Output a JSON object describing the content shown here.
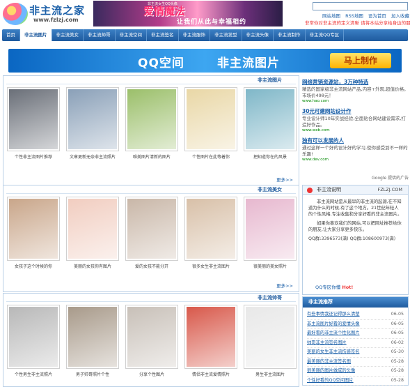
{
  "header": {
    "logo_text": "非主流之家",
    "logo_domain": "www.fzlzj.com",
    "banner_title": "爱情魔法",
    "banner_sub": "让我们从此与幸福相约",
    "banner_small": "非主流女生QQ头像",
    "top_links": [
      "网站地图",
      "RSS地图",
      "设为首页",
      "加入收藏"
    ],
    "tagline": "非常你对非主流的定义清晰 请将本站分享给身边的朋友"
  },
  "nav": {
    "items": [
      "首页",
      "非主流图片",
      "非主流美女",
      "非主流帅哥",
      "非主流空间",
      "非主流签名",
      "非主流服饰",
      "非主流发型",
      "非主流头像",
      "非主流制作",
      "非主流QQ专区"
    ],
    "active_index": 1
  },
  "big_banner": {
    "part1": "QQ空间",
    "part2": "非主流图片",
    "button": "马上制作"
  },
  "panels": [
    {
      "title": "非主流图片",
      "more": "更多>>",
      "items": [
        {
          "caption": "个性非主流图片推荐",
          "color": "#6a6f78"
        },
        {
          "caption": "文章更新无奈非主流照片",
          "color": "#8aa0b8"
        },
        {
          "caption": "唯美图片清新的图片",
          "color": "#9bbf6a"
        },
        {
          "caption": "个性图片在此等着你",
          "color": "#e9d7a6"
        },
        {
          "caption": "把知道你在的风景",
          "color": "#7fb7c8"
        }
      ]
    },
    {
      "title": "非主流美女",
      "more": "更多>>",
      "items": [
        {
          "caption": "女孩子这个时候的你",
          "color": "#c9a68a"
        },
        {
          "caption": "美丽的女孩你有图片",
          "color": "#f1cdc0"
        },
        {
          "caption": "爱的女孩不能分开",
          "color": "#c9b7a8"
        },
        {
          "caption": "很多女生非主流图片",
          "color": "#d8c0a8"
        },
        {
          "caption": "很美丽的美女照片",
          "color": "#e7b8cf"
        }
      ]
    },
    {
      "title": "非主流帅哥",
      "more": "",
      "items": [
        {
          "caption": "个性男生非主流照片",
          "color": "#b8b8b8"
        },
        {
          "caption": "男子帅哥照片个性",
          "color": "#a89a8a"
        },
        {
          "caption": "分享个性图片",
          "color": "#c8c0b8"
        },
        {
          "caption": "情侣非主流爱情照片",
          "color": "#d8584a"
        },
        {
          "caption": "男生非主流图片",
          "color": "#e8e8e8"
        }
      ]
    }
  ],
  "ads": [
    {
      "title": "网络营销资源站，3万种特选",
      "text": "精选的国家级非主流网站产品,内容+外观,超值价格。市场价498元！",
      "url": "www.hao.com"
    },
    {
      "title": "30元可建网站设计作",
      "text": "专业设计师10年实战经验,全面贴合网站建设需求,打造好作品。",
      "url": "www.web.com"
    },
    {
      "title": "独有可以发展的人",
      "text": "通过这样一个好的设计好的学习,使你感受到不一样的乐趣!",
      "url": "www.dev.com"
    }
  ],
  "google_ad": "Google 提供的广告",
  "info": {
    "head": "非主流说明",
    "domain": "FZLZJ.COM",
    "paragraphs": [
      "非主流网站是从最早的非主流的起源,在不知道为什么的时候,有了这个地方。21世纪年轻人的个性风格,专注收集和分享好看的非主流图片。",
      "如果你喜欢我们的网站,可以把网址推荐给你的朋友,让大家分享更多快乐。",
      "QQ群:3396573(满) QQ群:108600973(满)"
    ],
    "footer_label": "QQ专区你懂",
    "footer_hot": "Hot!"
  },
  "recommend": {
    "head": "非主流推荐",
    "rows": [
      {
        "title": "有些事情我还记得那么清楚",
        "date": "06-05"
      },
      {
        "title": "非主流图片好看的爱情头像",
        "date": "06-05"
      },
      {
        "title": "最好看的非主流个性化图片",
        "date": "06-05"
      },
      {
        "title": "帅哥非主流签名图片",
        "date": "06-02"
      },
      {
        "title": "美丽的女生非主流伤感签名",
        "date": "05-30"
      },
      {
        "title": "最美丽的非主流签名图",
        "date": "05-28"
      },
      {
        "title": "很美丽的图片做成的头像",
        "date": "05-28"
      },
      {
        "title": "个性好看的QQ空间图片",
        "date": "05-28"
      }
    ]
  }
}
